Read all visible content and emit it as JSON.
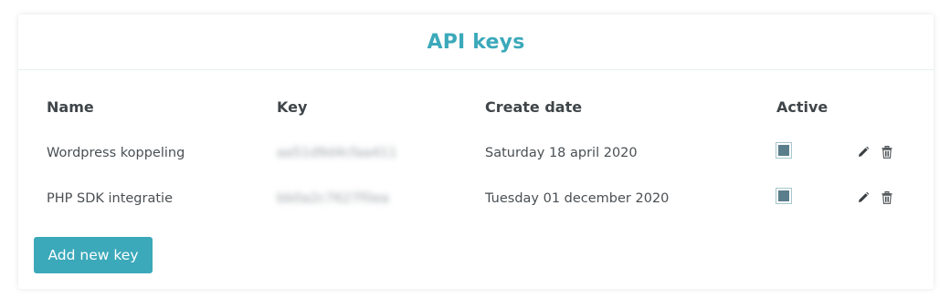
{
  "card": {
    "title": "API keys"
  },
  "table": {
    "columns": [
      "Name",
      "Key",
      "Create date",
      "Active"
    ],
    "rows": [
      {
        "name": "Wordpress koppeling",
        "key": "aa51d9d4cfaa411",
        "create_date": "Saturday 18 april 2020",
        "active": true,
        "actions": [
          "edit-pencil-icon",
          "delete-trash-icon"
        ]
      },
      {
        "name": "PHP SDK integratie",
        "key": "bb0a2c7627f0ea",
        "create_date": "Tuesday 01 december 2020",
        "active": true,
        "actions": [
          "edit-pencil-icon",
          "delete-trash-icon"
        ]
      }
    ]
  },
  "add_button": {
    "label": "Add new key"
  },
  "colors": {
    "accent": "#3ba9ba",
    "checkbox_fill": "#5a7e8c",
    "text": "#4a4f53",
    "header_text": "#3f4549"
  }
}
